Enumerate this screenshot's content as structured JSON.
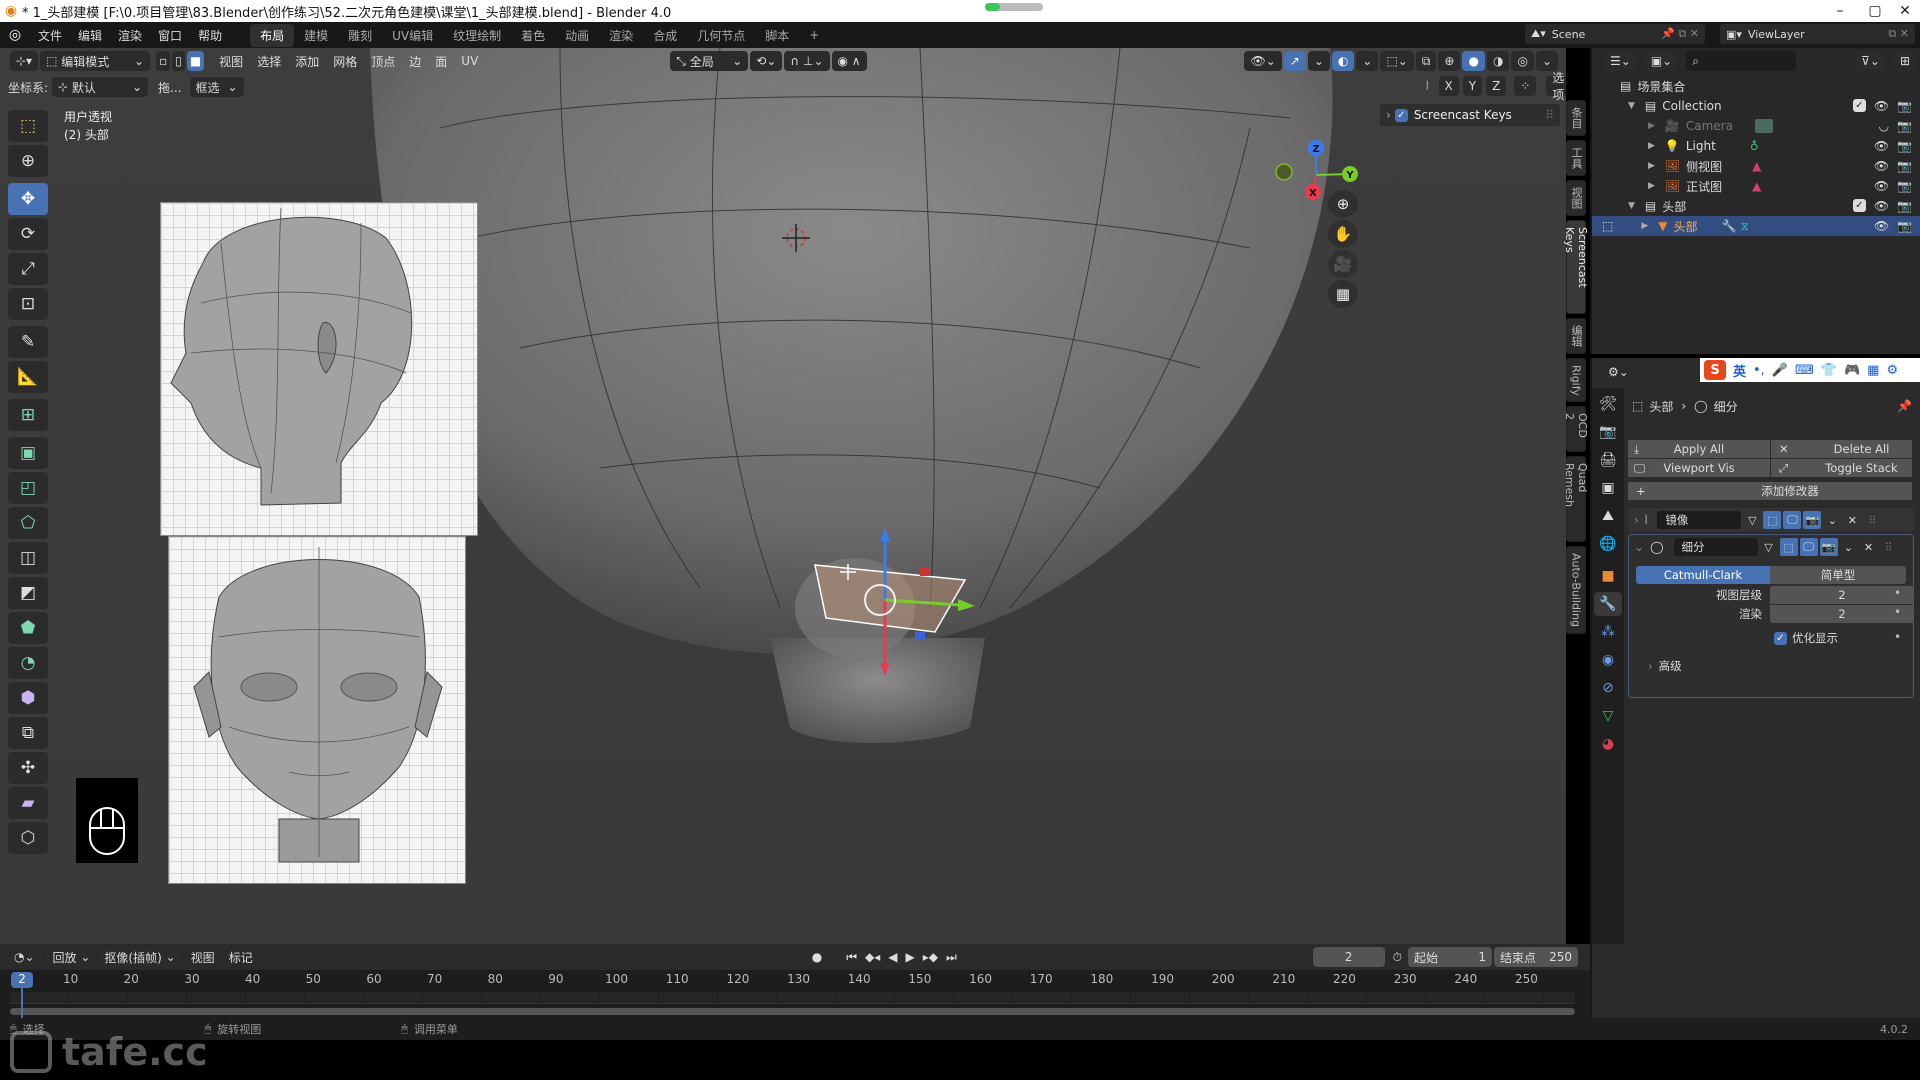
{
  "window": {
    "title": "* 1_头部建模 [F:\\0.项目管理\\83.Blender\\创作练习\\52.二次元角色建模\\课堂\\1_头部建模.blend] - Blender 4.0",
    "progress": 0.25,
    "controls": {
      "minimize": "–",
      "maximize": "▢",
      "close": "✕"
    }
  },
  "menubar": {
    "items": [
      "文件",
      "编辑",
      "渲染",
      "窗口",
      "帮助"
    ],
    "workspaces": [
      "布局",
      "建模",
      "雕刻",
      "UV编辑",
      "纹理绘制",
      "着色",
      "动画",
      "渲染",
      "合成",
      "几何节点",
      "脚本"
    ],
    "active_workspace": "布局",
    "add_workspace": "+",
    "scene": "Scene",
    "view_layer": "ViewLayer"
  },
  "viewport_header": {
    "mode": "编辑模式",
    "menus": [
      "视图",
      "选择",
      "添加",
      "网格",
      "顶点",
      "边",
      "面",
      "UV"
    ],
    "orientation": "全局",
    "axis_labels": [
      "X",
      "Y",
      "Z"
    ],
    "options": "选项"
  },
  "tool_settings": {
    "coord_label": "坐标系:",
    "coord_value": "默认",
    "drag_label": "拖...",
    "drag_value": "框选"
  },
  "overlay": {
    "view_name": "用户透视",
    "object_info": "(2) 头部"
  },
  "toolbar": {
    "tools": [
      "select-box",
      "cursor",
      "move",
      "rotate",
      "scale",
      "transform",
      "annotate",
      "measure",
      "add-cube",
      "extrude-region",
      "inset-faces",
      "bevel",
      "loop-cut",
      "knife",
      "poly-build",
      "spin",
      "smooth",
      "edge-slide",
      "shrink-fatten",
      "shear",
      "rip-region"
    ],
    "active": "move"
  },
  "gizmo": {
    "x": "X",
    "y": "Y",
    "z": "Z"
  },
  "screencast": {
    "label": "Screencast Keys",
    "checked": true
  },
  "n_panel_tabs": [
    "条目",
    "工具",
    "视图",
    "Screencast Keys",
    "编辑",
    "Rigify",
    "OCD 2",
    "Quad Remesh",
    "Auto-Building"
  ],
  "n_panel_active": "Screencast Keys",
  "outliner": {
    "root": "场景集合",
    "rows": [
      {
        "name": "Collection",
        "type": "collection",
        "level": 1,
        "checked": true
      },
      {
        "name": "Camera",
        "type": "camera",
        "level": 2,
        "dimmed": true
      },
      {
        "name": "Light",
        "type": "light",
        "level": 2
      },
      {
        "name": "侧视图",
        "type": "image",
        "level": 2
      },
      {
        "name": "正试图",
        "type": "image",
        "level": 2
      },
      {
        "name": "头部",
        "type": "collection",
        "level": 1,
        "checked": true
      },
      {
        "name": "头部",
        "type": "mesh",
        "level": 2,
        "selected": true
      }
    ]
  },
  "ime": {
    "lang": "英",
    "punct": "•,"
  },
  "properties": {
    "breadcrumb_object": "头部",
    "breadcrumb_modifier": "细分",
    "apply_all": "Apply All",
    "delete_all": "Delete All",
    "viewport_vis": "Viewport Vis",
    "toggle_stack": "Toggle Stack",
    "add_modifier": "添加修改器",
    "modifiers": [
      {
        "name": "镜像",
        "expanded": false
      },
      {
        "name": "细分",
        "expanded": true
      }
    ],
    "subdiv": {
      "type_options": [
        "Catmull-Clark",
        "简单型"
      ],
      "type_selected": "Catmull-Clark",
      "viewport_levels_label": "视图层级",
      "viewport_levels": "2",
      "render_label": "渲染",
      "render": "2",
      "optimal_display_label": "优化显示",
      "optimal_display": true,
      "advanced_label": "高级"
    }
  },
  "timeline": {
    "menus": [
      "回放",
      "抠像(插帧)",
      "视图",
      "标记"
    ],
    "current_frame": "2",
    "start_label": "起始",
    "start": "1",
    "end_label": "结束点",
    "end": "250",
    "ticks": [
      "10",
      "20",
      "30",
      "40",
      "50",
      "60",
      "70",
      "80",
      "90",
      "100",
      "110",
      "120",
      "130",
      "140",
      "150",
      "160",
      "170",
      "180",
      "190",
      "200",
      "210",
      "220",
      "230",
      "240",
      "250"
    ]
  },
  "statusbar": {
    "select": "选择",
    "rotate_view": "旋转视图",
    "call_menu": "调用菜单",
    "version": "4.0.2"
  },
  "watermark": "tafe.cc"
}
